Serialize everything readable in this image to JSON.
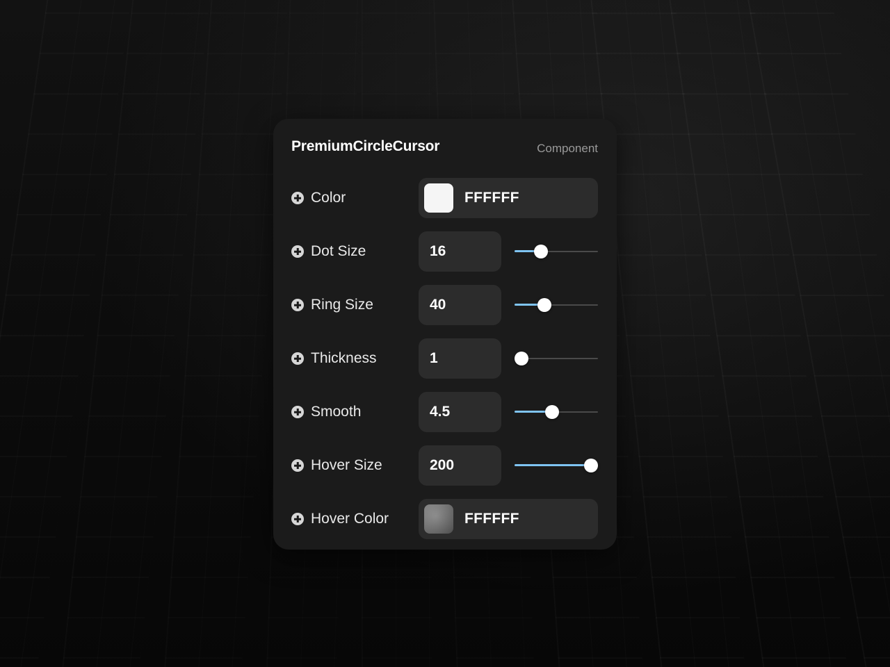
{
  "panel": {
    "title": "PremiumCircleCursor",
    "kind": "Component"
  },
  "accent_color": "#7fc4f2",
  "properties": [
    {
      "label": "Color",
      "type": "color",
      "value": "FFFFFF",
      "icon": "plus-circle-icon"
    },
    {
      "label": "Dot Size",
      "type": "number",
      "value": "16",
      "slider_fraction": 0.32,
      "icon": "plus-circle-icon"
    },
    {
      "label": "Ring Size",
      "type": "number",
      "value": "40",
      "slider_fraction": 0.36,
      "icon": "plus-circle-icon"
    },
    {
      "label": "Thickness",
      "type": "number",
      "value": "1",
      "slider_fraction": 0.08,
      "icon": "plus-circle-icon"
    },
    {
      "label": "Smooth",
      "type": "number",
      "value": "4.5",
      "slider_fraction": 0.45,
      "icon": "plus-circle-icon"
    },
    {
      "label": "Hover Size",
      "type": "number",
      "value": "200",
      "slider_fraction": 0.92,
      "icon": "plus-circle-icon"
    },
    {
      "label": "Hover Color",
      "type": "color",
      "value": "FFFFFF",
      "icon": "plus-circle-icon"
    }
  ]
}
